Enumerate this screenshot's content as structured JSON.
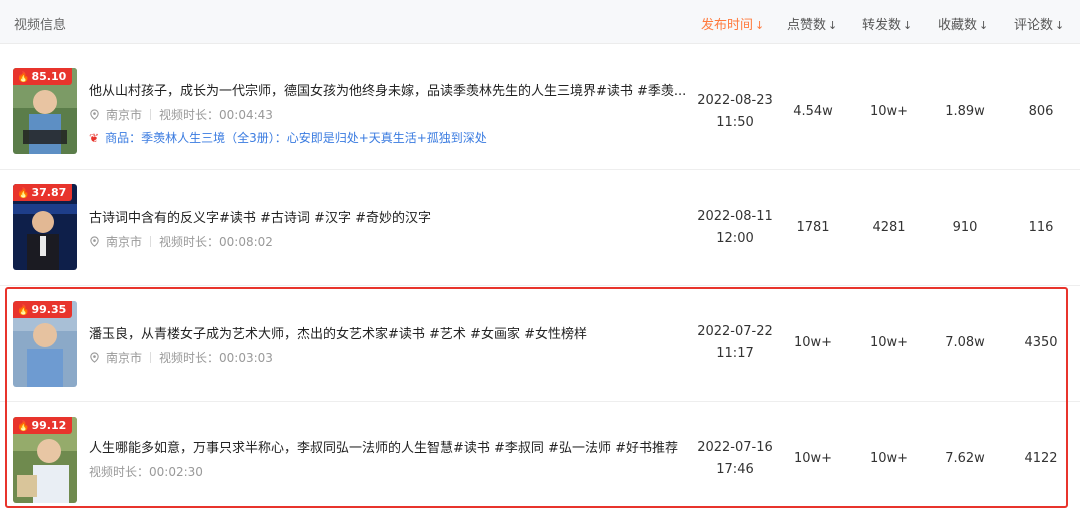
{
  "header": {
    "video_info": "视频信息",
    "columns": [
      {
        "label": "发布时间",
        "arrow": "↓",
        "active": true
      },
      {
        "label": "点赞数",
        "arrow": "↓",
        "active": false
      },
      {
        "label": "转发数",
        "arrow": "↓",
        "active": false
      },
      {
        "label": "收藏数",
        "arrow": "↓",
        "active": false
      },
      {
        "label": "评论数",
        "arrow": "↓",
        "active": false
      }
    ]
  },
  "rows": [
    {
      "score": "85.10",
      "title": "他从山村孩子，成长为一代宗师，德国女孩为他终身未嫁，品读季羡林先生的人生三境界#读书 #季羡...",
      "city": "南京市",
      "duration": "视频时长：00:04:43",
      "product": "商品：季羡林人生三境（全3册）：心安即是归处+天真生活+孤独到深处",
      "date": "2022-08-23",
      "time": "11:50",
      "likes": "4.54w",
      "shares": "10w+",
      "favorites": "1.89w",
      "comments": "806"
    },
    {
      "score": "37.87",
      "title": "古诗词中含有的反义字#读书 #古诗词 #汉字 #奇妙的汉字",
      "city": "南京市",
      "duration": "视频时长：00:08:02",
      "date": "2022-08-11",
      "time": "12:00",
      "likes": "1781",
      "shares": "4281",
      "favorites": "910",
      "comments": "116"
    },
    {
      "score": "99.35",
      "title": "潘玉良，从青楼女子成为艺术大师，杰出的女艺术家#读书 #艺术 #女画家 #女性榜样",
      "city": "南京市",
      "duration": "视频时长：00:03:03",
      "date": "2022-07-22",
      "time": "11:17",
      "likes": "10w+",
      "shares": "10w+",
      "favorites": "7.08w",
      "comments": "4350"
    },
    {
      "score": "99.12",
      "title": "人生哪能多如意，万事只求半称心，李叔同弘一法师的人生智慧#读书 #李叔同 #弘一法师 #好书推荐",
      "duration": "视频时长：00:02:30",
      "date": "2022-07-16",
      "time": "17:46",
      "likes": "10w+",
      "shares": "10w+",
      "favorites": "7.62w",
      "comments": "4122"
    }
  ],
  "colors": {
    "accent": "#ff7a3d",
    "badge": "#e8342c",
    "link": "#3a7be0",
    "highlight_border": "#e8342c"
  },
  "icons": {
    "badge": "fire-icon",
    "location": "location-pin-icon",
    "product": "heart-icon",
    "sort": "sort-arrow-down-icon"
  }
}
